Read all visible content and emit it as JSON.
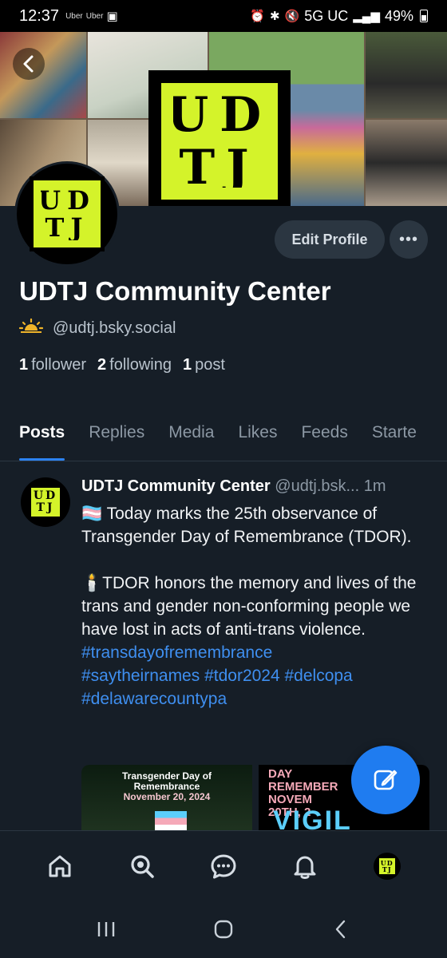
{
  "status_bar": {
    "time": "12:37",
    "notif_labels": [
      "Uber",
      "Uber"
    ],
    "network": "5G UC",
    "battery": "49%"
  },
  "banner": {
    "logo_line1": "UD",
    "logo_line2": "TJ"
  },
  "profile": {
    "name": "UDTJ Community Center",
    "handle": "@udtj.bsky.social",
    "edit_label": "Edit Profile",
    "followers_count": "1",
    "followers_label": "follower",
    "following_count": "2",
    "following_label": "following",
    "posts_count": "1",
    "posts_label": "post"
  },
  "tabs": [
    {
      "label": "Posts"
    },
    {
      "label": "Replies"
    },
    {
      "label": "Media"
    },
    {
      "label": "Likes"
    },
    {
      "label": "Feeds"
    },
    {
      "label": "Starte"
    }
  ],
  "post": {
    "author": "UDTJ Community Center",
    "handle_time": "@udtj.bsk... 1m",
    "para1": "🏳️‍⚧️ Today marks the 25th observance of Transgender Day of Remembrance (TDOR).",
    "para2": "🕯️TDOR honors the memory and lives of the trans and gender non-conforming people we have lost in acts of anti-trans violence.",
    "tags_line1": "#transdayofremembrance",
    "tags_line2": "#saytheirnames #tdor2024 #delcopa",
    "tags_line3": "#delawarecountypa",
    "image1_line1": "Transgender Day of",
    "image1_line2": "Remembrance",
    "image1_line3": "November 20, 2024",
    "image2_line1": "DAY",
    "image2_line2": "REMEMBER",
    "image2_line3": "NOVEM",
    "image2_line4": "20TH, 2",
    "image2_line5": "VIGIL"
  },
  "colors": {
    "background": "#161e27",
    "accent": "#1f7cf0",
    "brand_yellow": "#d4f32a",
    "link": "#3f8ff0"
  }
}
